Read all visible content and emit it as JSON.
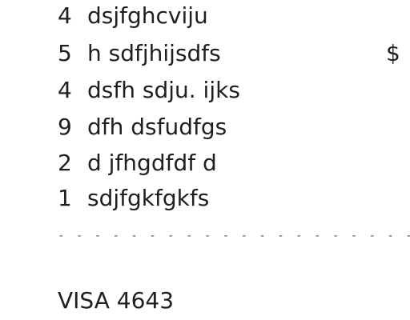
{
  "items": [
    {
      "qty": "4",
      "name": "dsjfghcviju",
      "price": ""
    },
    {
      "qty": "5",
      "name": "h sdfjhijsdfs",
      "price": "$"
    },
    {
      "qty": "4",
      "name": "dsfh sdju. ijks",
      "price": ""
    },
    {
      "qty": "9",
      "name": "dfh dsfudfgs",
      "price": ""
    },
    {
      "qty": "2",
      "name": "d jfhgdfdf d",
      "price": ""
    },
    {
      "qty": "1",
      "name": "sdjfgkfgkfs",
      "price": ""
    }
  ],
  "divider": "- - - - - - - - - - - - - - - - - - - - - - - - - - - - - - - -",
  "payment": {
    "label": "VISA 4643"
  }
}
